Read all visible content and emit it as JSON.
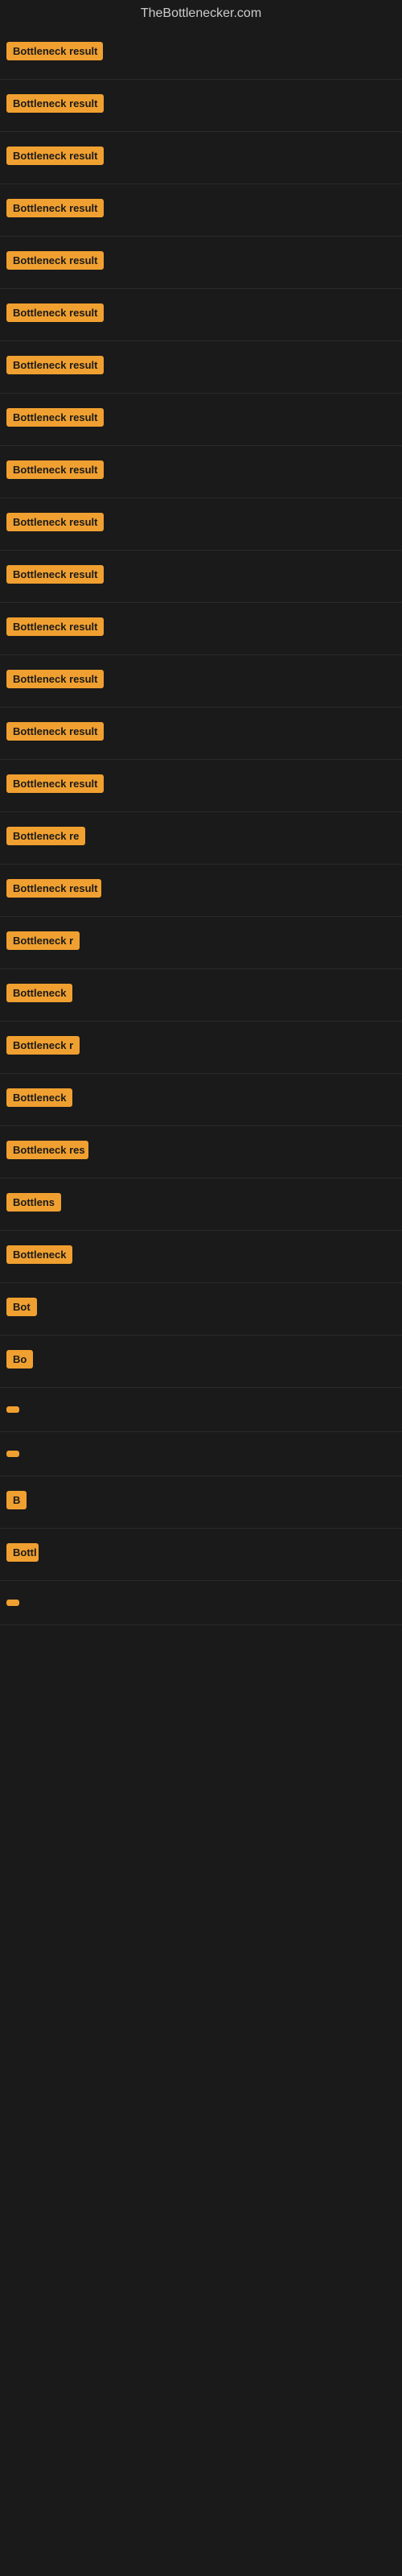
{
  "site": {
    "title": "TheBottlenecker.com"
  },
  "entries": [
    {
      "id": 1,
      "label": "Bottleneck result"
    },
    {
      "id": 2,
      "label": "Bottleneck result"
    },
    {
      "id": 3,
      "label": "Bottleneck result"
    },
    {
      "id": 4,
      "label": "Bottleneck result"
    },
    {
      "id": 5,
      "label": "Bottleneck result"
    },
    {
      "id": 6,
      "label": "Bottleneck result"
    },
    {
      "id": 7,
      "label": "Bottleneck result"
    },
    {
      "id": 8,
      "label": "Bottleneck result"
    },
    {
      "id": 9,
      "label": "Bottleneck result"
    },
    {
      "id": 10,
      "label": "Bottleneck result"
    },
    {
      "id": 11,
      "label": "Bottleneck result"
    },
    {
      "id": 12,
      "label": "Bottleneck result"
    },
    {
      "id": 13,
      "label": "Bottleneck result"
    },
    {
      "id": 14,
      "label": "Bottleneck result"
    },
    {
      "id": 15,
      "label": "Bottleneck result"
    },
    {
      "id": 16,
      "label": "Bottleneck re"
    },
    {
      "id": 17,
      "label": "Bottleneck result"
    },
    {
      "id": 18,
      "label": "Bottleneck r"
    },
    {
      "id": 19,
      "label": "Bottleneck"
    },
    {
      "id": 20,
      "label": "Bottleneck r"
    },
    {
      "id": 21,
      "label": "Bottleneck"
    },
    {
      "id": 22,
      "label": "Bottleneck res"
    },
    {
      "id": 23,
      "label": "Bottlens"
    },
    {
      "id": 24,
      "label": "Bottleneck"
    },
    {
      "id": 25,
      "label": "Bot"
    },
    {
      "id": 26,
      "label": "Bo"
    },
    {
      "id": 27,
      "label": ""
    },
    {
      "id": 28,
      "label": ""
    },
    {
      "id": 29,
      "label": "B"
    },
    {
      "id": 30,
      "label": "Bottl"
    },
    {
      "id": 31,
      "label": ""
    }
  ],
  "colors": {
    "badge_bg": "#f0a030",
    "body_bg": "#1a1a1a",
    "title_color": "#cccccc"
  }
}
